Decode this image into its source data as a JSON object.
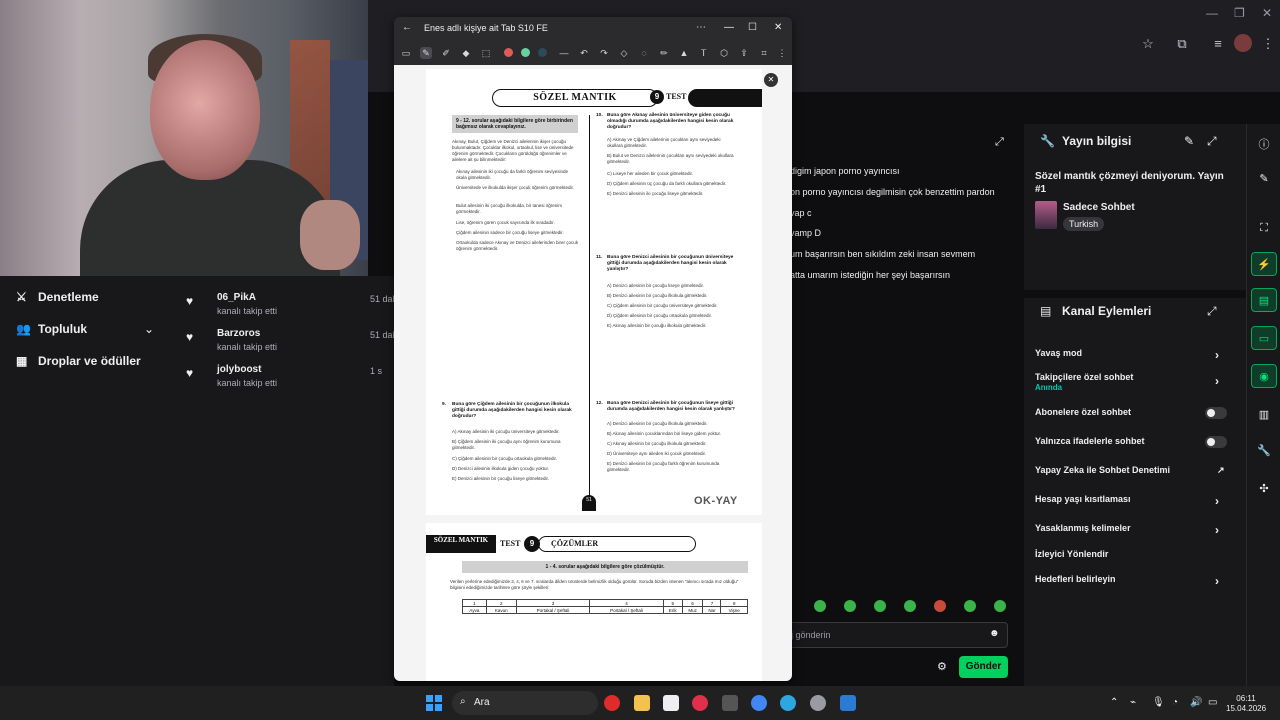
{
  "doc_window": {
    "title": "Enes adlı kişiye ait Tab S10 FE",
    "page1": {
      "banner": "SÖZEL MANTIK",
      "test_number": "9",
      "test_label": "TEST",
      "instruction": "9 - 12. sorular aşağıdaki bilgilere göre birbirinden bağımsız olarak cevaplayınız.",
      "intro": "Akınay, Bulut, Çiğdem ve Denizci ailelerinin ikişer çocuğu bulunmaktadır. Çocuklar ilkokul, ortaokul, lise ve üniversitede öğrenim görmektedir. Çocukların görüldüğü öğrenimler ve ailelere ait şu bilinmektedir:",
      "facts": [
        "Akınay ailesinin iki çocuğu da farklı öğrenim seviyesinde okula gitmektedir.",
        "Üniversitede ve ilkokulda ikişer çocuk öğrenim görmektedir.",
        "Bulut ailesinin iki çocuğu ilkokulda, bir tanesi öğrenim görmektedir.",
        "Lise, öğrenim gören çocuk sayısında ilk sıradadır.",
        "Çiğdem ailesinin sadece bir çocuğu liseye gitmektedir.",
        "Ortaokulda sadece Akınay ve Denizci ailelerinden birer çocuk öğrenim görmektedir."
      ],
      "q9": {
        "number": "9.",
        "text": "Buna göre Çiğdem ailesinin bir çocuğunun ilkokula gittiği durumda aşağıdakilerden hangisi kesin olarak doğrudur?",
        "options": [
          "A) Akınay ailesinin iki çocuğu üniversiteye gitmektedir.",
          "B) Çiğdem ailesinin iki çocuğu aynı öğrenim kurumuna gitmektedir.",
          "C) Çiğdem ailesinin bir çocuğu ortaokula gitmektedir.",
          "D) Denizci ailesinin ilkokula giden çocuğu yoktur.",
          "E) Denizci ailesinin bir çocuğu liseye gitmektedir."
        ]
      },
      "q10": {
        "number": "10.",
        "text": "Buna göre Akınay ailesinin üniversiteye giden çocuğu olmadığı durumda aşağıdakilerden hangisi kesin olarak doğrudur?",
        "options": [
          "A) Akınay ve Çiğdem ailelerinin çocukları aynı seviyedeki okullara gitmektedir.",
          "B) Bulut ve Denizci ailelerinin çocukları aynı seviyedeki okullara gitmektedir.",
          "C) Liseye her aileden bir çocuk gitmektedir.",
          "D) Çiğdem ailesinin üç çocuğu da farklı okullara gitmektedir.",
          "E) Denizci ailesinin iki çocuğu liseye gitmektedir."
        ]
      },
      "q11": {
        "number": "11.",
        "text": "Buna göre Denizci ailesinin bir çocuğunun üniversiteye gittiği durumda aşağıdakilerden hangisi kesin olarak yanlıştır?",
        "options": [
          "A) Denizci ailesinin bir çocuğu liseye gitmektedir.",
          "B) Denizci ailesinin bir çocuğu ilkokula gitmektedir.",
          "C) Çiğdem ailesinin bir çocuğu üniversiteye gitmektedir.",
          "D) Çiğdem ailesinin bir çocuğu ortaokula gitmektedir.",
          "E) Akınay ailesinin bir çocuğu ilkokula gitmektedir."
        ]
      },
      "q12": {
        "number": "12.",
        "text": "Buna göre Denizci ailesinin bir çocuğunun liseye gittiği durumda aşağıdakilerden hangisi kesin olarak yanlıştır?",
        "options": [
          "A) Denizci ailesinin bir çocuğu ilkokula gitmektedir.",
          "B) Akınay ailesinin çocuklarından biri liseye gidem yoktur.",
          "C) Akınay ailesinin bir çocuğu ilkokula gitmektedir.",
          "D) Üniversiteye aynı aileden iki çocuk gitmektedir.",
          "E) Denizci ailesinin bir çocuğu farklı öğrenim kurumunda gitmektedir."
        ]
      },
      "footer_brand": "OK-YAY",
      "page_number": "51"
    },
    "page2": {
      "subject": "SÖZEL MANTIK",
      "test_label": "TEST",
      "test_number": "9",
      "title": "ÇÖZÜMLER",
      "instruction": "1 - 4. sorular aşağıdaki bilgilere göre çözülmüştür.",
      "intro": "Verilen yerlerine edediğimizde 3, 4, 6 ve 7. sıralarda dilden ürünlerde belirsizlik olduğu görülür. Soruda bizden istenen \"akınıcı sırada mız olduğu\" bilgisini edediğimizde tarihlere göre şöyle şekilleri:",
      "table_header": [
        "1",
        "2",
        "3",
        "4",
        "5",
        "6",
        "7",
        "8"
      ],
      "table_row": [
        "Ayva",
        "Kavun",
        "Portakal / Şeftali",
        "Portakal / Şeftali",
        "Erik",
        "Muz",
        "Nar",
        "Vişne"
      ]
    }
  },
  "left_nav": [
    {
      "label": "Denetleme",
      "icon": "sword-icon"
    },
    {
      "label": "Topluluk",
      "icon": "community-icon"
    },
    {
      "label": "Droplar ve ödüller",
      "icon": "gift-icon"
    }
  ],
  "activity_feed": [
    {
      "name": "06_PikA",
      "action": "kanalı takip etti",
      "time": "51 dak"
    },
    {
      "name": "Barzoros",
      "action": "kanalı takip etti",
      "time": "51 dak"
    },
    {
      "name": "jolyboost",
      "action": "kanalı takip etti",
      "time": "1 s"
    }
  ],
  "chat_messages": [
    "digim japon porno yayıncısı",
    "on porno yayıncısı degilmisin çok benzettim pardon",
    "vap c",
    "vamp D",
    "um başarırsın ben sıkıldım zeki insan sevmem",
    "atta umarım istediğin her şeyi başarırsın"
  ],
  "stream_info": {
    "header": "Yayın bilgisi",
    "title": "Sözel mantık çözmeyi deniyorum. Yayın #1",
    "category": "Sadece Sohbet",
    "tag": "Turkish"
  },
  "channel_actions": {
    "header": "Kanal Eylemleri",
    "items": [
      {
        "label": "Yavaş mod",
        "control": "chevron"
      },
      {
        "label": "Takipçilere özel sohbet",
        "sub": "Anında",
        "control": "chevron"
      },
      {
        "label": "Abonelere özel sohbet",
        "control": "toggle"
      },
      {
        "label": "Yalnızca ifadelerle sohbet",
        "control": "toggle"
      },
      {
        "label": "Yapay Zeka ile Sohbet Denetimi",
        "control": "external"
      },
      {
        "label": "Hesap yaşı kısıtlaması",
        "control": "chevron"
      },
      {
        "label": "Yasaklanmış kelimeler",
        "control": "chevron"
      },
      {
        "label": "İzleyici Yönlendir",
        "control": "none"
      },
      {
        "label": "Hedefleri belirleyin",
        "control": "chevron"
      }
    ]
  },
  "chat_input": {
    "placeholder": "j gönderin",
    "send_label": "Gönder"
  },
  "taskbar": {
    "search_label": "Ara",
    "time": "06:11",
    "date": "15.04.2026"
  },
  "colors": {
    "accent_green": "#00d15e",
    "sub_teal": "#00c8af",
    "bg": "#0e0e10",
    "panel": "#18181b"
  }
}
